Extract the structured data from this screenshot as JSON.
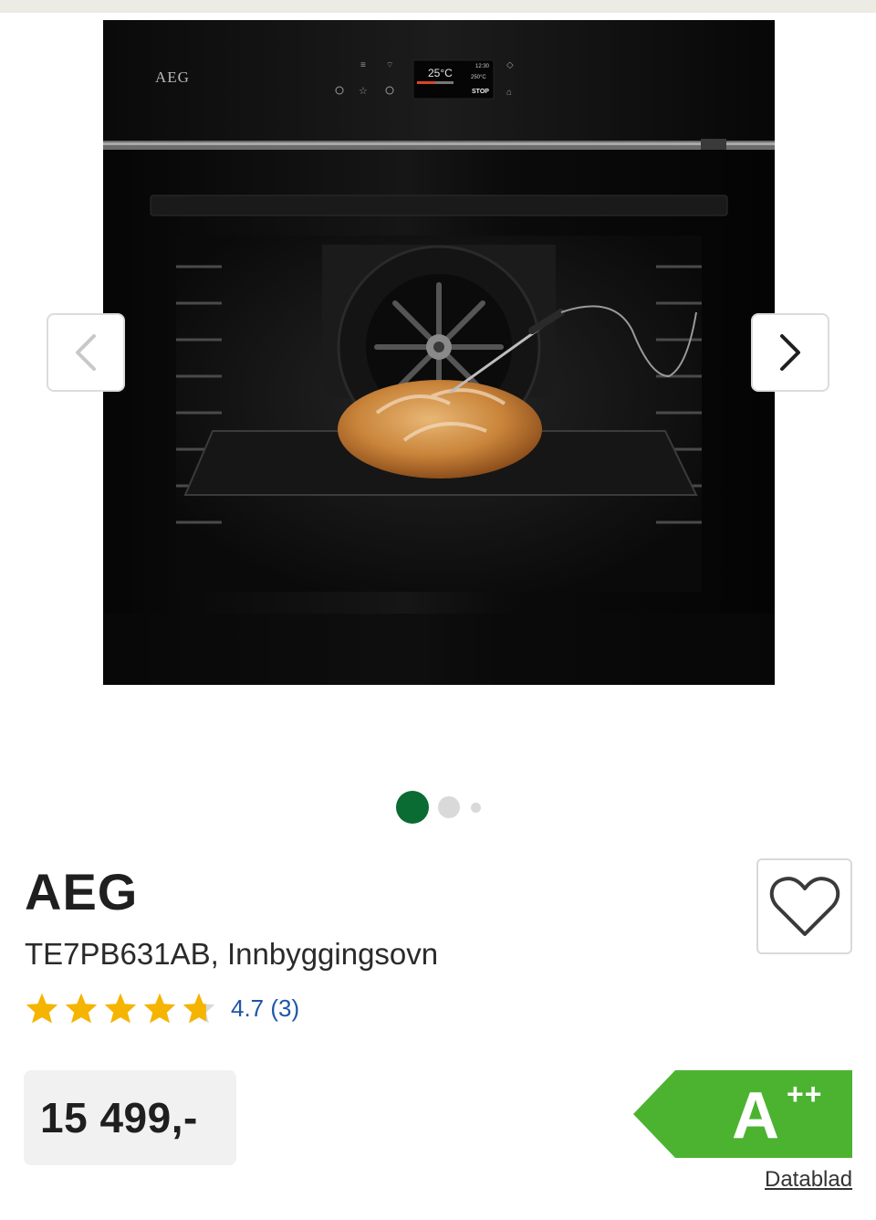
{
  "gallery": {
    "image_alt": "AEG TE7PB631AB, Innbyggingsovn",
    "oven_logo": "AEG",
    "display": {
      "temp": "25°C",
      "clock": "12:30",
      "set_temp": "250°C",
      "stop": "STOP"
    },
    "dots_total": 3,
    "active_dot": 1
  },
  "product": {
    "brand": "AEG",
    "model": "TE7PB631AB, Innbyggingsovn",
    "rating_value": 4.7,
    "rating_text": "4.7 (3)",
    "price": "15 499,-"
  },
  "energy": {
    "class": "A",
    "plus": "++",
    "datasheet_label": "Datablad",
    "color": "#4cb331"
  },
  "colors": {
    "accent_green": "#0a6b33",
    "star_yellow": "#f5b400",
    "link_blue": "#1e56a8"
  }
}
